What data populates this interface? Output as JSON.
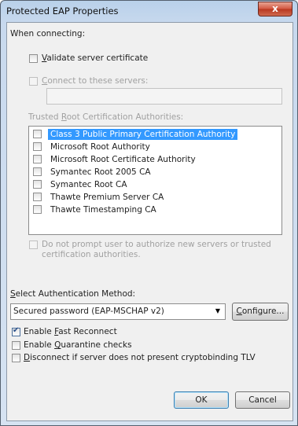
{
  "window": {
    "title": "Protected EAP Properties",
    "close_glyph": "x"
  },
  "connecting": {
    "heading": "When connecting:",
    "validate_cert": {
      "prefix": "",
      "accel": "V",
      "rest": "alidate server certificate",
      "checked": false
    },
    "connect_servers": {
      "prefix": "",
      "accel": "C",
      "rest": "onnect to these servers:",
      "checked": false,
      "value": ""
    },
    "trusted_heading": {
      "prefix": "Trusted ",
      "accel": "R",
      "rest": "oot Certification Authorities:"
    },
    "authorities": [
      {
        "label": "Class 3 Public Primary Certification Authority",
        "checked": false,
        "selected": true
      },
      {
        "label": "Microsoft Root Authority",
        "checked": false,
        "selected": false
      },
      {
        "label": "Microsoft Root Certificate Authority",
        "checked": false,
        "selected": false
      },
      {
        "label": "Symantec Root 2005 CA",
        "checked": false,
        "selected": false
      },
      {
        "label": "Symantec Root CA",
        "checked": false,
        "selected": false
      },
      {
        "label": "Thawte Premium Server CA",
        "checked": false,
        "selected": false
      },
      {
        "label": "Thawte Timestamping CA",
        "checked": false,
        "selected": false
      }
    ],
    "no_prompt": {
      "line1": "Do not prompt user to authorize new servers or trusted",
      "line2": "certification authorities.",
      "checked": false
    }
  },
  "auth": {
    "heading": {
      "prefix": "",
      "accel": "S",
      "rest": "elect Authentication Method:"
    },
    "method": "Secured password (EAP-MSCHAP v2)",
    "configure": {
      "prefix": "",
      "accel": "C",
      "rest": "onfigure..."
    }
  },
  "options": {
    "fast_reconnect": {
      "prefix": "Enable ",
      "accel": "F",
      "rest": "ast Reconnect",
      "checked": true
    },
    "quarantine": {
      "prefix": "Enable ",
      "accel": "Q",
      "rest": "uarantine checks",
      "checked": false
    },
    "cryptobinding": {
      "prefix": "",
      "accel": "D",
      "rest": "isconnect if server does not present cryptobinding TLV",
      "checked": false
    }
  },
  "buttons": {
    "ok": "OK",
    "cancel": "Cancel"
  },
  "icons": {
    "dropdown": "chevron-down-icon",
    "close": "close-icon",
    "check": "checkmark-icon"
  }
}
